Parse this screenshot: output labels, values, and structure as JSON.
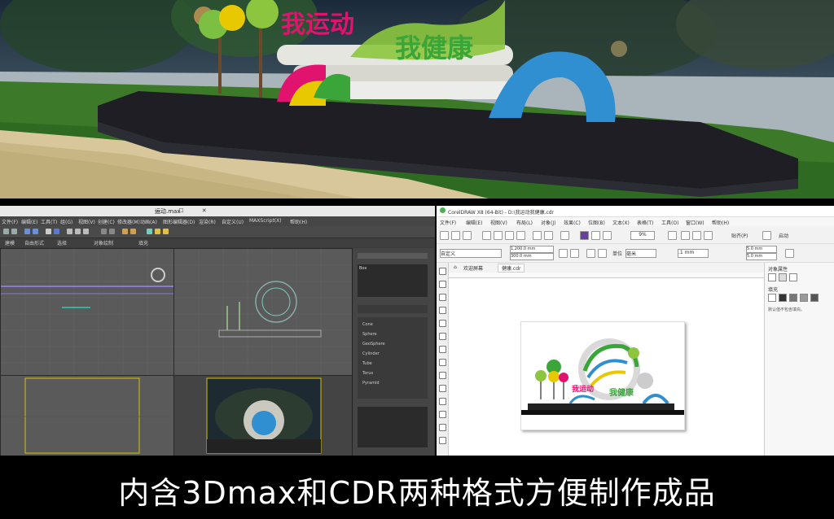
{
  "render": {
    "slogan_left": "我运动",
    "slogan_right": "我健康"
  },
  "max_window": {
    "title": "运动.max",
    "window_controls": "— ☐ ✕",
    "menu": [
      "文件(F)",
      "编辑(E)",
      "工具(T)",
      "组(G)",
      "视图(V)",
      "创建(C)",
      "修改器(M)",
      "动画(A)",
      "图形编辑器(D)",
      "渲染(R)",
      "自定义(U)",
      "MAXScript(X)",
      "帮助(H)"
    ],
    "ribbon": [
      "建模",
      "自由形式",
      "选择",
      "对象绘制",
      "填充"
    ],
    "panel_items": [
      "Box",
      "Cone",
      "Sphere",
      "GeoSphere",
      "Cylinder",
      "Tube",
      "Torus",
      "Pyramid"
    ]
  },
  "cdr_window": {
    "title": "CorelDRAW X8 (64-Bit) - D:\\我运动我健康.cdr",
    "menu": [
      "文件(F)",
      "编辑(E)",
      "视图(V)",
      "布局(L)",
      "对象(J)",
      "效果(C)",
      "位图(B)",
      "文本(X)",
      "表格(T)",
      "工具(O)",
      "窗口(W)",
      "帮助(H)"
    ],
    "zoom": "9%",
    "paste_label": "贴齐(P)",
    "launch_label": "启动",
    "page_preset": "自定义",
    "width": "1,200.0 mm",
    "height": "300.0 mm",
    "units_label": "单位",
    "units": "毫米",
    "nudge": ".1 mm",
    "dup_x": "5.0 mm",
    "dup_y": "5.0 mm",
    "tabs": [
      "欢迎屏幕",
      "健康.cdr"
    ],
    "art_left": "我运动",
    "art_right": "我健康",
    "right_panel": {
      "title": "对象属性",
      "fill_label": "填充",
      "no_fill_text": "默认值不包含填充。"
    }
  },
  "caption": "内含3Dmax和CDR两种格式方便制作成品",
  "colors": {
    "green": "#3aa63a",
    "magenta": "#e0136f",
    "blue": "#2f8fd0",
    "yellow": "#e8c800"
  }
}
